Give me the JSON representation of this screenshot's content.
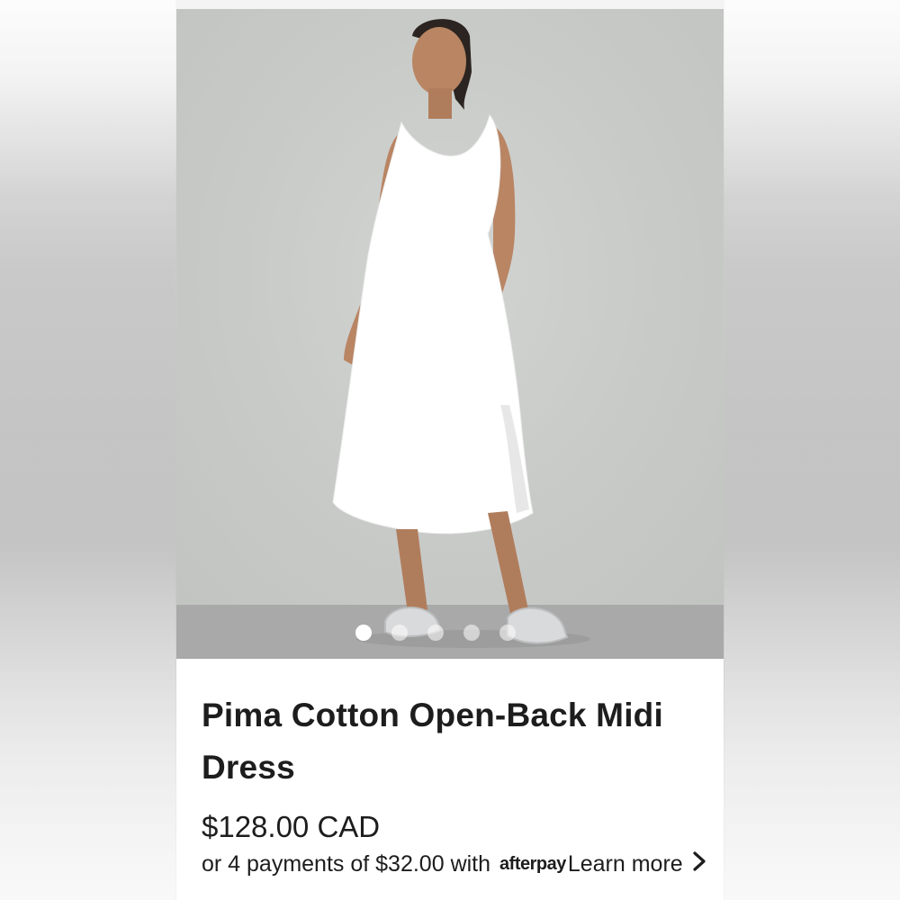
{
  "product": {
    "title": "Pima Cotton Open-Back Midi Dress",
    "price": "$128.00 CAD",
    "payment_text": "or 4 payments of $32.00 with",
    "payment_brand": "afterpay",
    "learn_more": "Learn more"
  },
  "gallery": {
    "image_count": 5,
    "active_index": 0,
    "dress_color": "#ffffff",
    "background_color": "#c9cbc9"
  },
  "icons": {
    "learn_more_chevron": "chevron-right-icon"
  }
}
